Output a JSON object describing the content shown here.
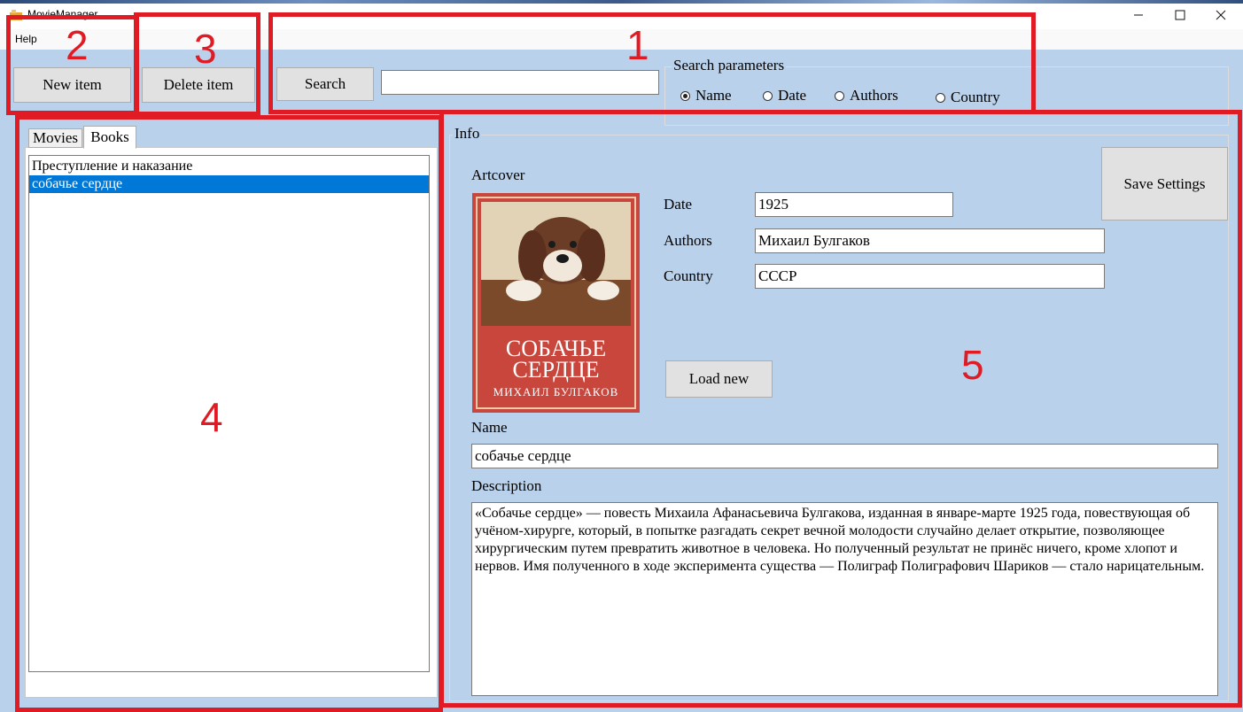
{
  "window": {
    "title": "MovieManager",
    "minimize_icon": "minimize-icon",
    "maximize_icon": "maximize-icon",
    "close_icon": "close-icon"
  },
  "menu": {
    "help_label": "Help"
  },
  "toolbar": {
    "new_item_label": "New item",
    "delete_item_label": "Delete item",
    "search_label": "Search",
    "search_value": ""
  },
  "search_parameters": {
    "title": "Search parameters",
    "options": [
      {
        "label": "Name",
        "checked": true
      },
      {
        "label": "Date",
        "checked": false
      },
      {
        "label": "Authors",
        "checked": false
      },
      {
        "label": "Country",
        "checked": false
      }
    ]
  },
  "tabs": [
    {
      "label": "Movies",
      "active": false
    },
    {
      "label": "Books",
      "active": true
    }
  ],
  "items": [
    {
      "label": "Преступление и наказание",
      "selected": false
    },
    {
      "label": "собачье сердце",
      "selected": true
    }
  ],
  "info": {
    "title": "Info",
    "artcover_label": "Artcover",
    "save_settings_label": "Save Settings",
    "date_label": "Date",
    "date_value": "1925",
    "authors_label": "Authors",
    "authors_value": "Михаил Булгаков",
    "country_label": "Country",
    "country_value": "СССР",
    "load_new_label": "Load new",
    "name_label": "Name",
    "name_value": "собачье сердце",
    "description_label": "Description",
    "description_value": "«Собачье сердце» — повесть Михаила Афанасьевича Булгакова, изданная в январе-марте 1925 года, повествующая об учёном-хирурге, который, в попытке разгадать секрет вечной молодости случайно делает открытие, позволяющее хирургическим путем превратить животное в человека. Но полученный результат не принёс ничего, кроме хлопот и нервов. Имя полученного в ходе эксперимента существа — Полиграф Полиграфович Шариков — стало нарицательным.",
    "cover": {
      "title_line1": "СОБАЧЬЕ",
      "title_line2": "СЕРДЦЕ",
      "author": "МИХАИЛ БУЛГАКОВ"
    }
  },
  "annotations": [
    "1",
    "2",
    "3",
    "4",
    "5"
  ],
  "colors": {
    "background": "#b9d1ea",
    "selection": "#0078d7",
    "annotation": "#e01b24"
  }
}
